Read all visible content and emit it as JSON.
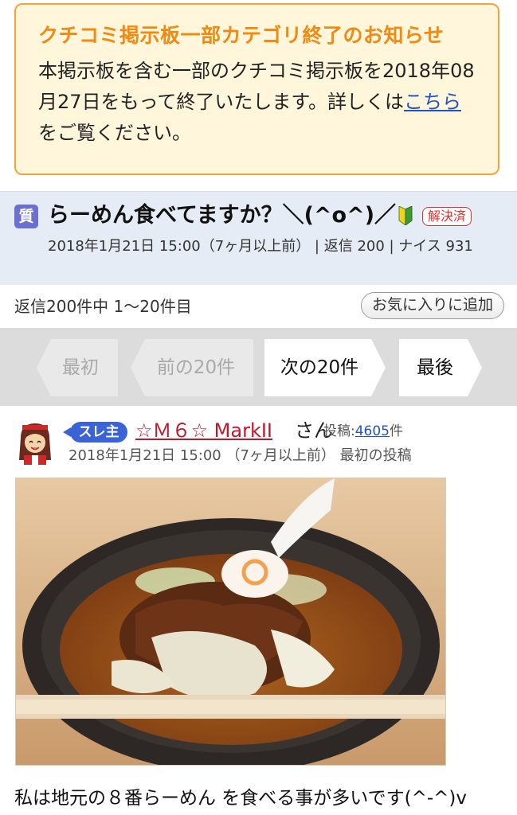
{
  "notice": {
    "title": "クチコミ掲示板一部カテゴリ終了のお知らせ",
    "body_before_link": "本掲示板を含む一部のクチコミ掲示板を2018年08月27日をもって終了いたします。詳しくは",
    "link_text": "こちら",
    "body_after_link": "をご覧ください。",
    "accent_color": "#f08a12"
  },
  "thread": {
    "type_badge": "質",
    "title": "らーめん食べてますか？＼(^o^)／",
    "beginner_icon": "beginner-mark-icon",
    "resolved_label": "解決済",
    "meta": "2018年1月21日 15:00（7ヶ月以上前） | 返信 200 | ナイス 931"
  },
  "replies": {
    "count_text": "返信200件中 1～20件目",
    "favorite_label": "お気に入りに追加"
  },
  "pager": {
    "first": "最初",
    "prev": "前の20件",
    "next": "次の20件",
    "last": "最後"
  },
  "post": {
    "op_badge": "スレ主",
    "user_name": "☆Ｍ６☆ MarkII",
    "user_suffix": "さん",
    "post_count_label": "投稿:",
    "post_count_value": "4605",
    "post_count_unit": "件",
    "meta": "2018年1月21日 15:00 （7ヶ月以上前） 最初の投稿",
    "image_icon": "ramen-photo",
    "text": "私は地元の８番らーめん を食べる事が多いです(^-^)v"
  }
}
